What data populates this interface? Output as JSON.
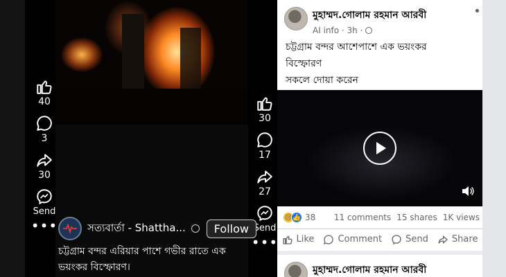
{
  "reels": [
    {
      "likes": "40",
      "comments": "3",
      "shares": "30",
      "send_label": "Send",
      "more": "•••"
    },
    {
      "likes": "30",
      "comments": "17",
      "shares": "27",
      "send_label": "Send",
      "more": "•••"
    }
  ],
  "reel_info": {
    "channel_name": "সত্যবার্তা - Shattha...",
    "follow_label": "Follow",
    "caption": "চট্টগ্রাম বন্দর এরিয়ার পাশে গভীর রাতে এক ভয়ংকর বিস্ফোরণ।"
  },
  "post": {
    "author": "মুহাম্মদ.গোলাম রহমান আরবী",
    "meta": "AI info · 3h ·",
    "menu": "•••",
    "text_line1": "চট্টগ্রাম বন্দর আশেপাশে  এক ভয়ংকর",
    "text_line2": "বিস্ফোরণ",
    "text_line3": "সকলে দোয়া করেন",
    "reaction_count": "38",
    "comments": "11 comments",
    "shares": "15 shares",
    "views": "1K views",
    "like_label": "Like",
    "comment_label": "Comment",
    "send_label": "Send",
    "share_label": "Share"
  },
  "post2": {
    "author": "মুহাম্মদ.গোলাম রহমান আরবী"
  },
  "colors": {
    "fb_blue": "#1877f2",
    "fire": "#ff7a18",
    "reel_bg": "#000000"
  }
}
